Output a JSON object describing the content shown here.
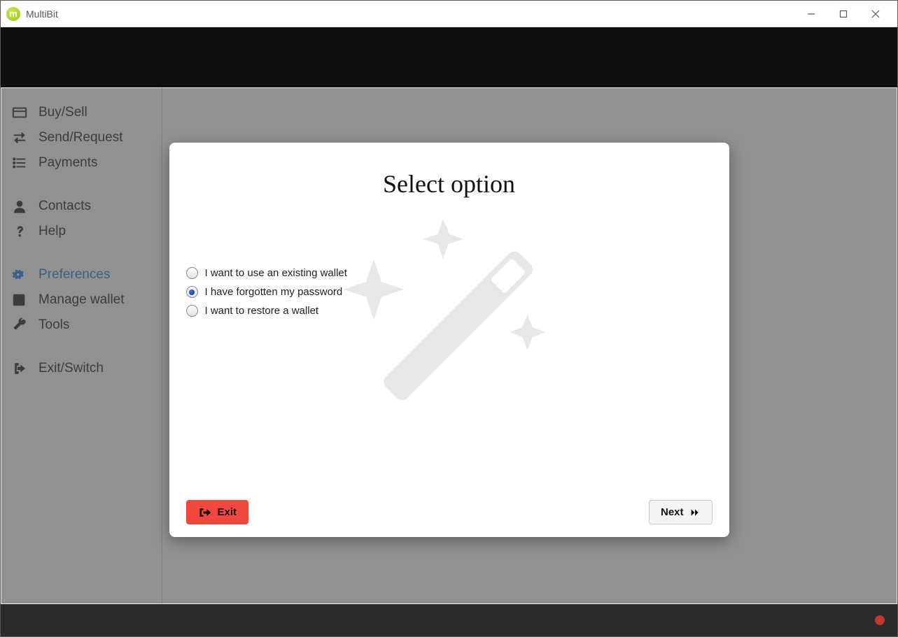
{
  "titlebar": {
    "app_name": "MultiBit"
  },
  "sidebar": {
    "groups": [
      {
        "items": [
          {
            "key": "buy-sell",
            "label": "Buy/Sell"
          },
          {
            "key": "send-request",
            "label": "Send/Request"
          },
          {
            "key": "payments",
            "label": "Payments"
          }
        ]
      },
      {
        "items": [
          {
            "key": "contacts",
            "label": "Contacts"
          },
          {
            "key": "help",
            "label": "Help"
          }
        ]
      },
      {
        "items": [
          {
            "key": "preferences",
            "label": "Preferences",
            "active": true
          },
          {
            "key": "manage-wallet",
            "label": "Manage wallet"
          },
          {
            "key": "tools",
            "label": "Tools"
          }
        ]
      },
      {
        "items": [
          {
            "key": "exit-switch",
            "label": "Exit/Switch"
          }
        ]
      }
    ]
  },
  "dialog": {
    "title": "Select option",
    "options": [
      {
        "key": "use-existing",
        "label": "I want to use an existing wallet",
        "checked": false
      },
      {
        "key": "forgot-password",
        "label": "I have forgotten my password",
        "checked": true
      },
      {
        "key": "restore-wallet",
        "label": "I want to restore a wallet",
        "checked": false
      }
    ],
    "exit_label": "Exit",
    "next_label": "Next"
  },
  "footer": {
    "status": "disconnected"
  }
}
